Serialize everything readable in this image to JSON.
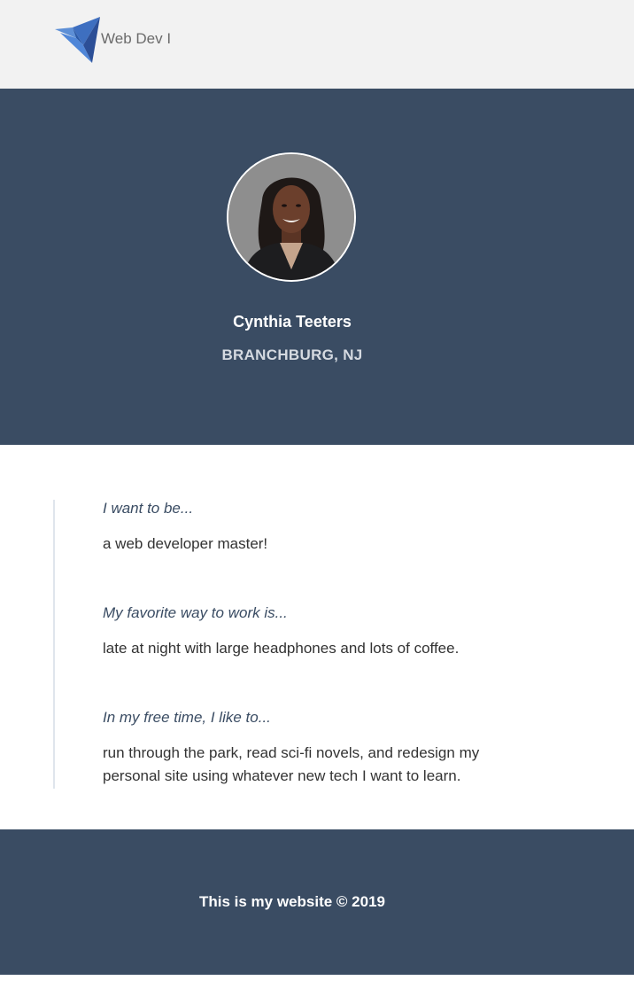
{
  "header": {
    "brand": "Web Dev I",
    "logo_icon": "origami-bird-icon"
  },
  "profile": {
    "name": "Cynthia Teeters",
    "location": "BRANCHBURG, NJ",
    "avatar_icon": "profile-photo"
  },
  "about": [
    {
      "question": "I want to be...",
      "answer": "a web developer master!"
    },
    {
      "question": "My favorite way to work is...",
      "answer": "late at night with large headphones and lots of coffee."
    },
    {
      "question": "In my free time, I like to...",
      "answer": "run through the park, read sci-fi novels, and redesign my personal site using whatever new tech I want to learn."
    }
  ],
  "footer": {
    "text": "This is my website © 2019"
  },
  "colors": {
    "header_bg": "#f2f2f2",
    "hero_bg": "#3a4c63",
    "accent": "#3a4c63",
    "text": "#333333"
  }
}
